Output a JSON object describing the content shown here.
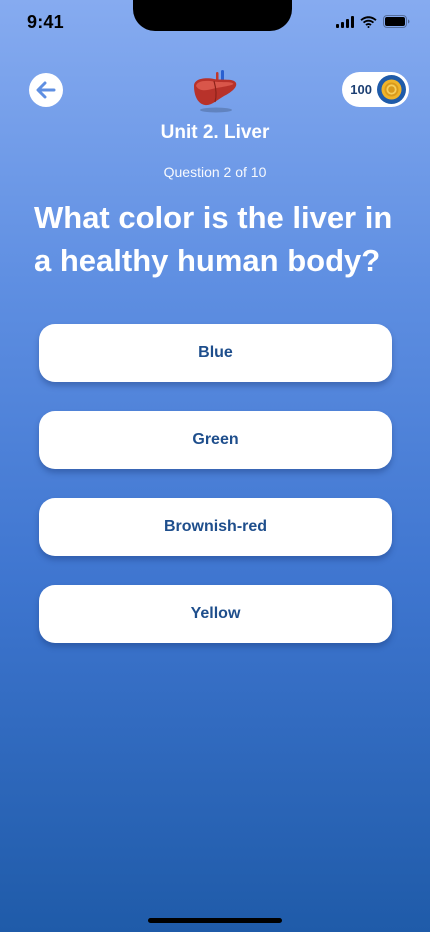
{
  "status_bar": {
    "time": "9:41",
    "icons": [
      "signal-icon",
      "wifi-icon",
      "battery-icon"
    ]
  },
  "header": {
    "back_icon": "arrow-left-icon",
    "unit_icon": "liver-icon",
    "coins": "100",
    "coin_icon": "coin-icon"
  },
  "quiz": {
    "unit_title": "Unit 2. Liver",
    "progress": "Question 2 of 10",
    "question": "What color is the liver in a healthy human body?",
    "answers": [
      "Blue",
      "Green",
      "Brownish-red",
      "Yellow"
    ]
  },
  "colors": {
    "gradient_top": "#86abf0",
    "gradient_bottom": "#1f5ba9",
    "answer_text": "#1e4e8c",
    "coin_gold": "#e8a524"
  }
}
